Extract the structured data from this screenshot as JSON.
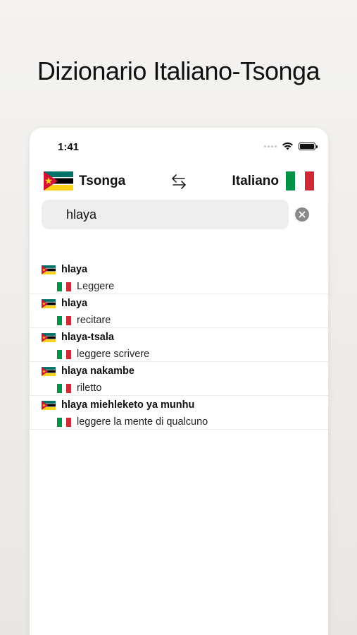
{
  "headline": "Dizionario Italiano-Tsonga",
  "status": {
    "time": "1:41"
  },
  "languages": {
    "source": "Tsonga",
    "target": "Italiano"
  },
  "search": {
    "value": "hlaya"
  },
  "colors": {
    "italy_green": "#009246",
    "italy_white": "#ffffff",
    "italy_red": "#ce2b37",
    "moz_green": "#007168",
    "moz_black": "#000000",
    "moz_yellow": "#fcd116",
    "moz_red": "#d21034",
    "moz_white": "#ffffff"
  },
  "results": [
    {
      "source": "hlaya",
      "translation": "Leggere"
    },
    {
      "source": "hlaya",
      "translation": "recitare"
    },
    {
      "source": "hlaya-tsala",
      "translation": "leggere scrivere"
    },
    {
      "source": "hlaya nakambe",
      "translation": "riletto"
    },
    {
      "source": "hlaya miehleketo ya munhu",
      "translation": "leggere la mente di qualcuno"
    }
  ]
}
